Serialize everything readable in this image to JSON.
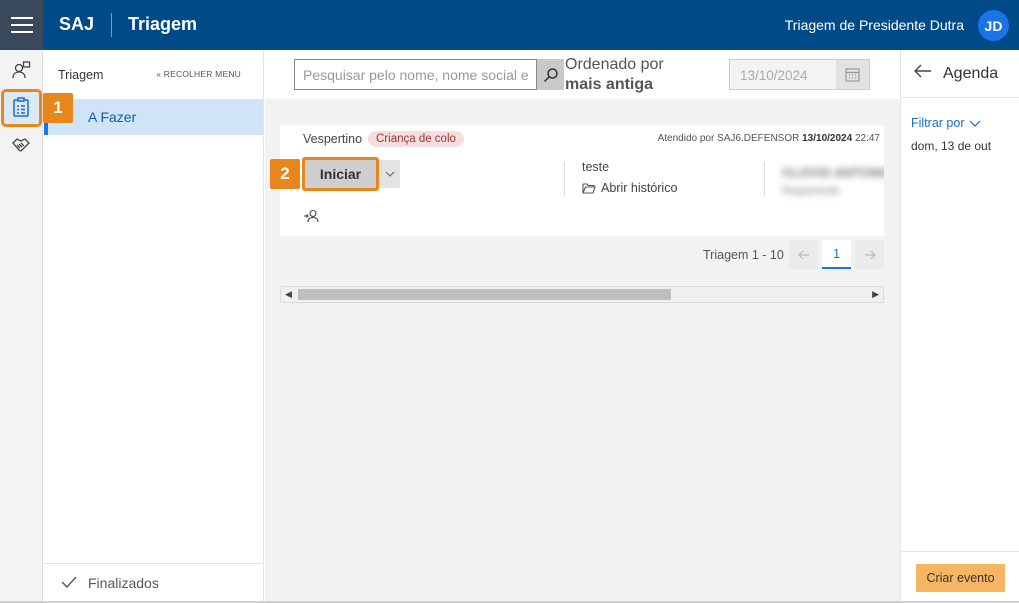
{
  "header": {
    "brand": "SAJ",
    "app_title": "Triagem",
    "unit_name": "Triagem de Presidente Dutra",
    "avatar_initials": "JD",
    "bar_color": "#004b87"
  },
  "sidemenu": {
    "title": "Triagem",
    "collapse_label": "« RECOLHER MENU",
    "active_item": "A Fazer",
    "footer_item": "Finalizados"
  },
  "toolbar": {
    "search_placeholder": "Pesquisar pelo nome, nome social e",
    "order_label": "Ordenado por",
    "order_value": "mais antiga",
    "date_value": "13/10/2024"
  },
  "card": {
    "period": "Vespertino",
    "badge": "Criança de colo",
    "attended_prefix": "Atendido por SAJ6.DEFENSOR",
    "attended_datetime": "13/10/2024",
    "attended_time": "22:47",
    "start_label": "Iniciar",
    "note": "teste",
    "history_label": "Abrir histórico",
    "blurred_name": "CLOVIS ANTONIO",
    "blurred_sub": "Requerente",
    "badge_bg": "#f5dede",
    "badge_color": "#a03434"
  },
  "pagination": {
    "label": "Triagem 1 - 10",
    "current_page": "1",
    "prev_icon": "arrow-left-icon",
    "next_icon": "arrow-right-icon"
  },
  "agenda": {
    "title": "Agenda",
    "filter_label": "Filtrar por",
    "filter_date": "dom, 13 de out",
    "create_label": "Criar evento",
    "create_color": "#f7b562"
  },
  "callouts": {
    "one": "1",
    "two": "2",
    "color": "#e8861c"
  }
}
